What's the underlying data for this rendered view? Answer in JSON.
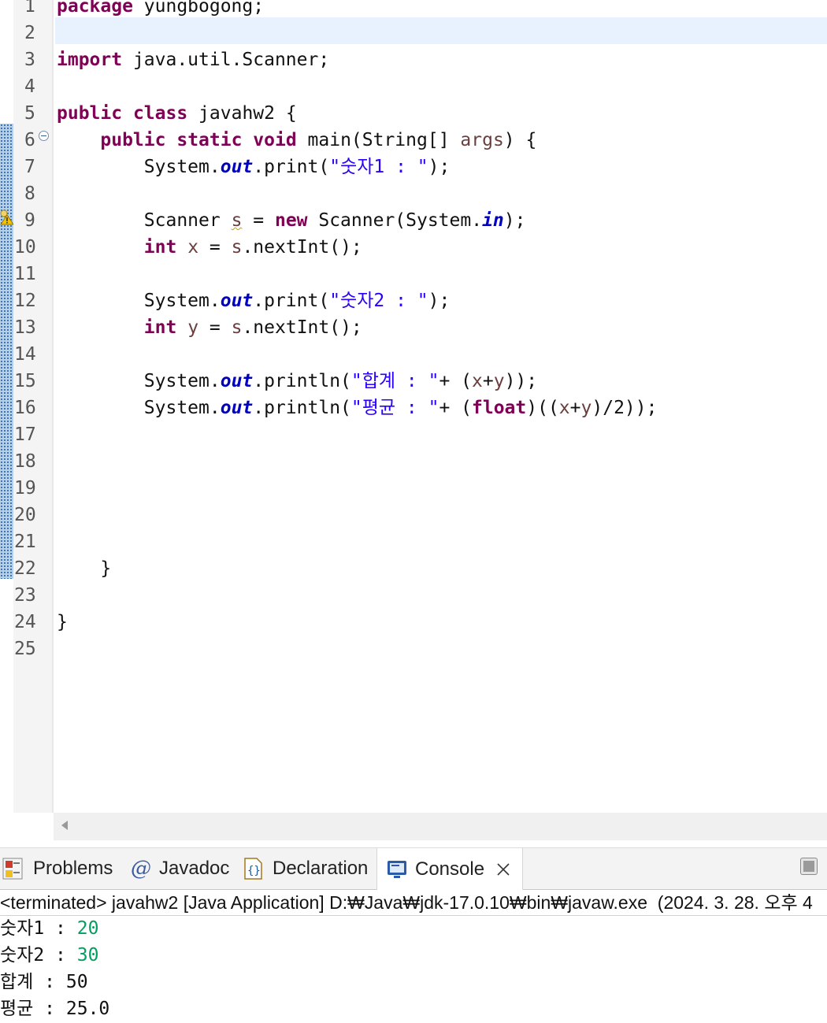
{
  "editor": {
    "line_numbers": [
      "1",
      "2",
      "3",
      "4",
      "5",
      "6",
      "7",
      "8",
      "9",
      "10",
      "11",
      "12",
      "13",
      "14",
      "15",
      "16",
      "17",
      "18",
      "19",
      "20",
      "21",
      "22",
      "23",
      "24",
      "25"
    ],
    "code": {
      "l1_kw": "package",
      "l1_rest": " yungbogong;",
      "l3_kw": "import",
      "l3_rest": " java.util.Scanner;",
      "l5_kw1": "public",
      "l5_kw2": "class",
      "l5_rest": " javahw2 {",
      "l6_indent": "    ",
      "l6_kw1": "public",
      "l6_kw2": "static",
      "l6_kw3": "void",
      "l6_a": " main(String[] ",
      "l6_args": "args",
      "l6_b": ") {",
      "l7_indent": "        ",
      "l7_a": "System.",
      "l7_out": "out",
      "l7_b": ".print(",
      "l7_str": "\"숫자1 : \"",
      "l7_c": ");",
      "l9_indent": "        ",
      "l9_a": "Scanner ",
      "l9_s": "s",
      "l9_b": " = ",
      "l9_new": "new",
      "l9_c": " Scanner(System.",
      "l9_in": "in",
      "l9_d": ");",
      "l10_indent": "        ",
      "l10_int": "int",
      "l10_a": " ",
      "l10_x": "x",
      "l10_b": " = ",
      "l10_s": "s",
      "l10_c": ".nextInt();",
      "l12_indent": "        ",
      "l12_a": "System.",
      "l12_out": "out",
      "l12_b": ".print(",
      "l12_str": "\"숫자2 : \"",
      "l12_c": ");",
      "l13_indent": "        ",
      "l13_int": "int",
      "l13_a": " ",
      "l13_y": "y",
      "l13_b": " = ",
      "l13_s": "s",
      "l13_c": ".nextInt();",
      "l15_indent": "        ",
      "l15_a": "System.",
      "l15_out": "out",
      "l15_b": ".println(",
      "l15_str": "\"합계 : \"",
      "l15_c": "+ (",
      "l15_x": "x",
      "l15_d": "+",
      "l15_y": "y",
      "l15_e": "));",
      "l16_indent": "        ",
      "l16_a": "System.",
      "l16_out": "out",
      "l16_b": ".println(",
      "l16_str": "\"평균 : \"",
      "l16_c": "+ (",
      "l16_float": "float",
      "l16_d": ")((",
      "l16_x": "x",
      "l16_e": "+",
      "l16_y": "y",
      "l16_f": ")/2));",
      "l22": "    }",
      "l24": "}"
    }
  },
  "views": {
    "tabs": [
      "Problems",
      "Javadoc",
      "Declaration",
      "Console"
    ],
    "console_header": "<terminated> javahw2 [Java Application] D:₩Java₩jdk-17.0.10₩bin₩javaw.exe  (2024. 3. 28. 오후 4",
    "output": [
      {
        "prompt": "숫자1 : ",
        "input": "20"
      },
      {
        "prompt": "숫자2 : ",
        "input": "30"
      },
      {
        "prompt": "합계 : ",
        "input": "50"
      },
      {
        "prompt": "평균 : ",
        "input": "25.0"
      }
    ]
  },
  "colors": {
    "keyword": "#7f0055",
    "string": "#2a00ff",
    "field": "#0000c0",
    "local_var": "#6a3e3e",
    "console_input": "#00a060"
  }
}
